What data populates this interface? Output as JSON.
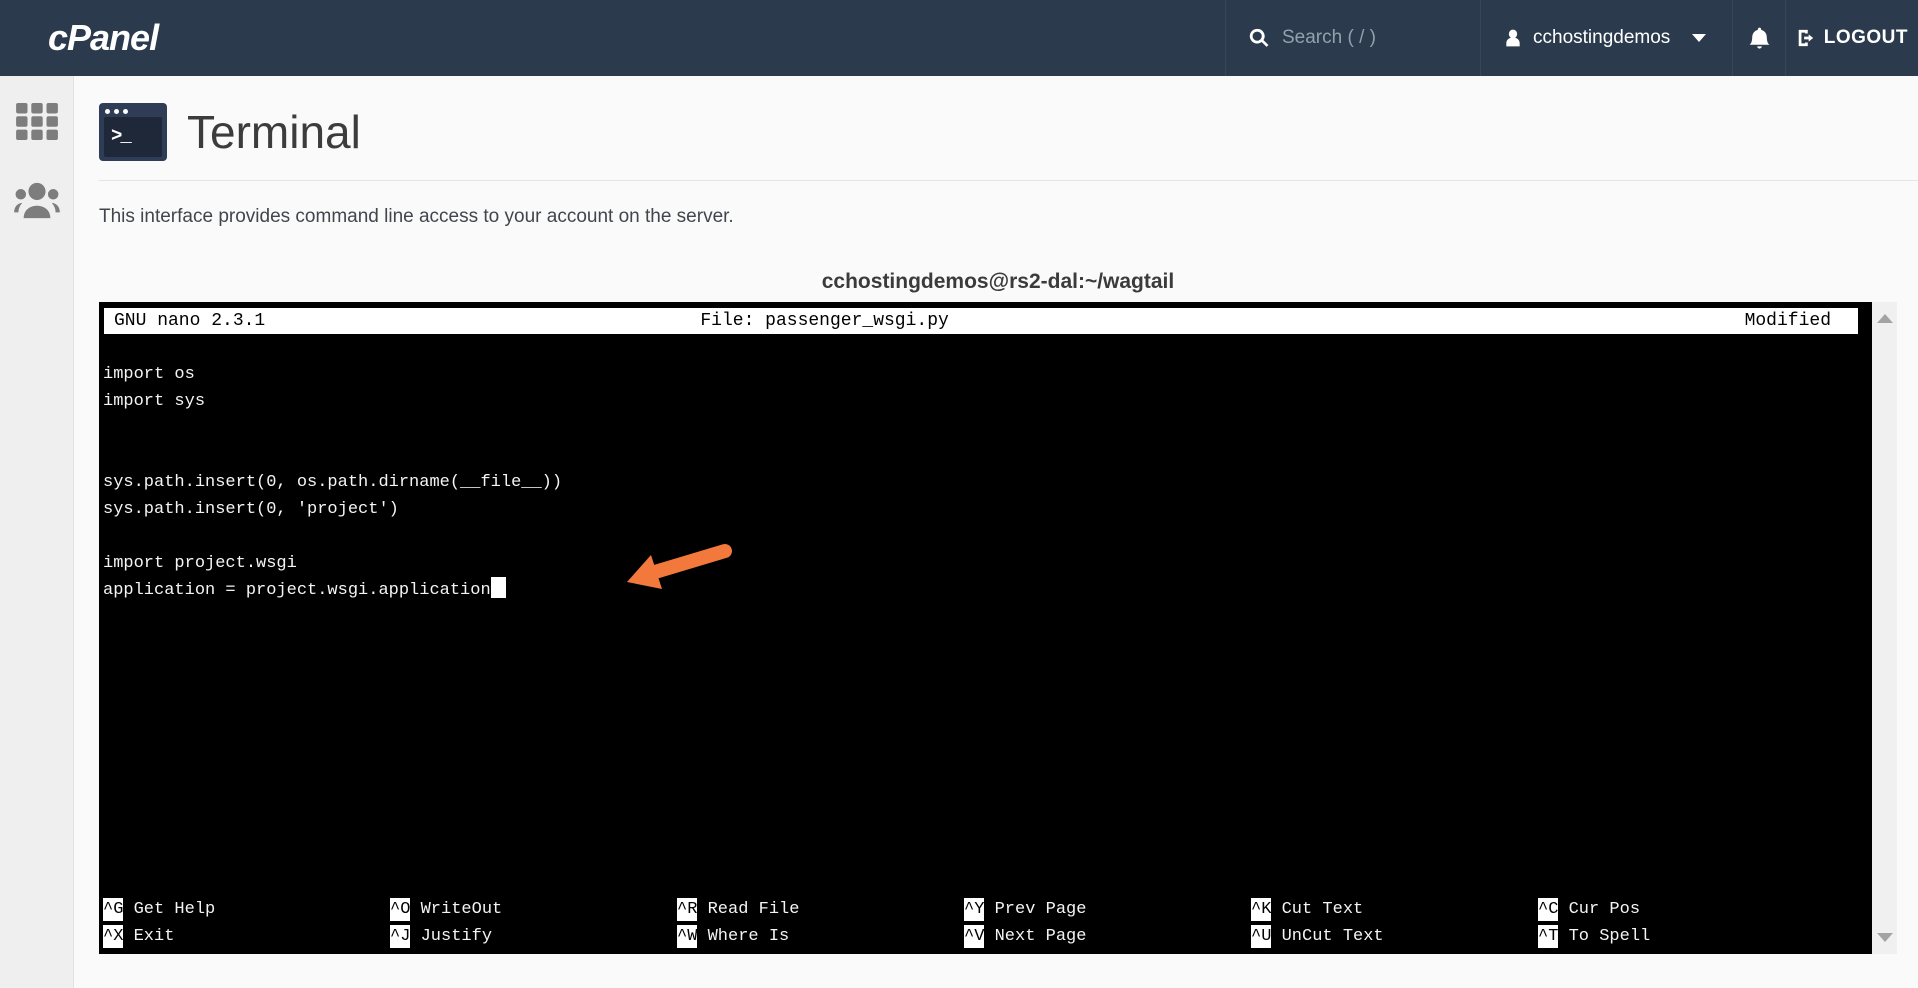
{
  "navbar": {
    "logo": "cPanel",
    "search_placeholder": "Search ( / )",
    "username": "cchostingdemos",
    "logout_label": "LOGOUT"
  },
  "page": {
    "title": "Terminal",
    "description": "This interface provides command line access to your account on the server."
  },
  "terminal": {
    "title": "cchostingdemos@rs2-dal:~/wagtail",
    "nano_header": {
      "version": "GNU nano 2.3.1",
      "file": "File: passenger_wsgi.py",
      "modified": "Modified"
    },
    "code_lines": [
      "import os",
      "import sys",
      "",
      "",
      "sys.path.insert(0, os.path.dirname(__file__))",
      "sys.path.insert(0, 'project')",
      "",
      "import project.wsgi",
      "application = project.wsgi.application"
    ],
    "cursor_after_line": 8,
    "shortcuts": [
      {
        "key": "^G",
        "label": "Get Help"
      },
      {
        "key": "^O",
        "label": "WriteOut"
      },
      {
        "key": "^R",
        "label": "Read File"
      },
      {
        "key": "^Y",
        "label": "Prev Page"
      },
      {
        "key": "^K",
        "label": "Cut Text"
      },
      {
        "key": "^C",
        "label": "Cur Pos"
      },
      {
        "key": "^X",
        "label": "Exit"
      },
      {
        "key": "^J",
        "label": "Justify"
      },
      {
        "key": "^W",
        "label": "Where Is"
      },
      {
        "key": "^V",
        "label": "Next Page"
      },
      {
        "key": "^U",
        "label": "UnCut Text"
      },
      {
        "key": "^T",
        "label": "To Spell"
      }
    ]
  },
  "colors": {
    "navbar_bg": "#2b3b4d",
    "terminal_bg": "#000000",
    "arrow": "#f2793b",
    "nano_bar_bg": "#ffffff"
  }
}
